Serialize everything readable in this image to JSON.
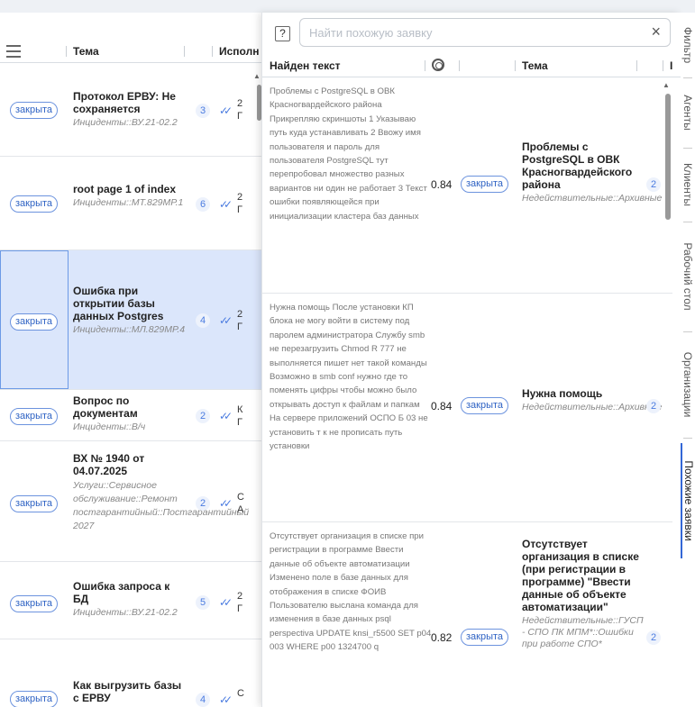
{
  "list": {
    "columns": {
      "topic": "Тема",
      "executor": "Исполн"
    },
    "rows": [
      {
        "status": "закрыта",
        "title": "Протокол ЕРВУ: Не сохраняется",
        "category": "Инциденты::ВУ.21-02.2",
        "count": "3",
        "executor": "2\nГ",
        "selected": false
      },
      {
        "status": "закрыта",
        "title": "root page 1 of index",
        "category": "Инциденты::МТ.829МР.1",
        "count": "6",
        "executor": "2\nГ",
        "selected": false
      },
      {
        "status": "закрыта",
        "title": "Ошибка при открытии базы данных Postgres",
        "category": "Инциденты::МЛ.829МР.4",
        "count": "4",
        "executor": "2\nГ",
        "selected": true
      },
      {
        "status": "закрыта",
        "title": "Вопрос по документам",
        "category": "Инциденты::В/ч",
        "count": "2",
        "executor": "К\nГ",
        "selected": false
      },
      {
        "status": "закрыта",
        "title": "ВХ № 1940 от 04.07.2025",
        "category": "Услуги::Сервисное обслуживание::Ремонт постгарантийный::Постгарантийный 2027",
        "count": "2",
        "executor": "С\nА",
        "selected": false
      },
      {
        "status": "закрыта",
        "title": "Ошибка запроса к БД",
        "category": "Инциденты::ВУ.21-02.2",
        "count": "5",
        "executor": "2\nГ",
        "selected": false
      },
      {
        "status": "закрыта",
        "title": "Как выгрузить базы с ЕРВУ",
        "category": "",
        "count": "4",
        "executor": "С",
        "selected": false
      }
    ]
  },
  "panel": {
    "help_label": "?",
    "search_placeholder": "Найти похожую заявку",
    "clear_label": "×",
    "columns": {
      "found_text": "Найден текст",
      "topic": "Тема",
      "extra": "I"
    },
    "rows": [
      {
        "found_text": "Проблемы с PostgreSQL в ОВК Красногвардейского района Прикрепляю скриншоты 1 Указываю путь куда устанавливать 2 Ввожу имя пользователя и пароль для пользователя PostgreSQL тут перепробовал множество разных вариантов ни один не работает 3 Текст ошибки появляющейся при инициализации кластера баз данных",
        "score": "0.84",
        "status": "закрыта",
        "title": "Проблемы с PostgreSQL в ОВК Красногвардейского района",
        "category": "Недействительные::Архивные",
        "count": "2"
      },
      {
        "found_text": "Нужна помощь После установки КП блока не могу войти в систему под паролем администратора Службу smb не перезагрузить Chmod R 777 не выполняется пишет нет такой команды Возможно в smb conf нужно где то поменять цифры чтобы можно было открывать доступ к файлам и папкам На сервере приложений ОСПО Б 03 не установить т к не прописать путь установки",
        "score": "0.84",
        "status": "закрыта",
        "title": "Нужна помощь",
        "category": "Недействительные::Архивные",
        "count": "2"
      },
      {
        "found_text": "Отсутствует организация в списке при регистрации в программе Ввести данные об объекте автоматизации Изменено поле в базе данных для отображения в списке ФОИВ Пользователю выслана команда для изменения в базе данных psql perspectiva UPDATE knsi_r5500 SET p04 003 WHERE p00 1324700 q",
        "score": "0.82",
        "status": "закрыта",
        "title": "Отсутствует организация в списке (при регистрации в программе) \"Ввести данные об объекте автоматизации\"",
        "category": "Недействительные::ГУСП - СПО ПК МПМ*::Ошибки при работе СПО*",
        "count": "2"
      }
    ]
  },
  "tabs": [
    {
      "label": "Фильтр",
      "active": false
    },
    {
      "label": "Агенты",
      "active": false
    },
    {
      "label": "Клиенты",
      "active": false
    },
    {
      "label": "Рабочий стол",
      "active": false
    },
    {
      "label": "Организации",
      "active": false
    },
    {
      "label": "Похожие заявки",
      "active": true
    }
  ]
}
